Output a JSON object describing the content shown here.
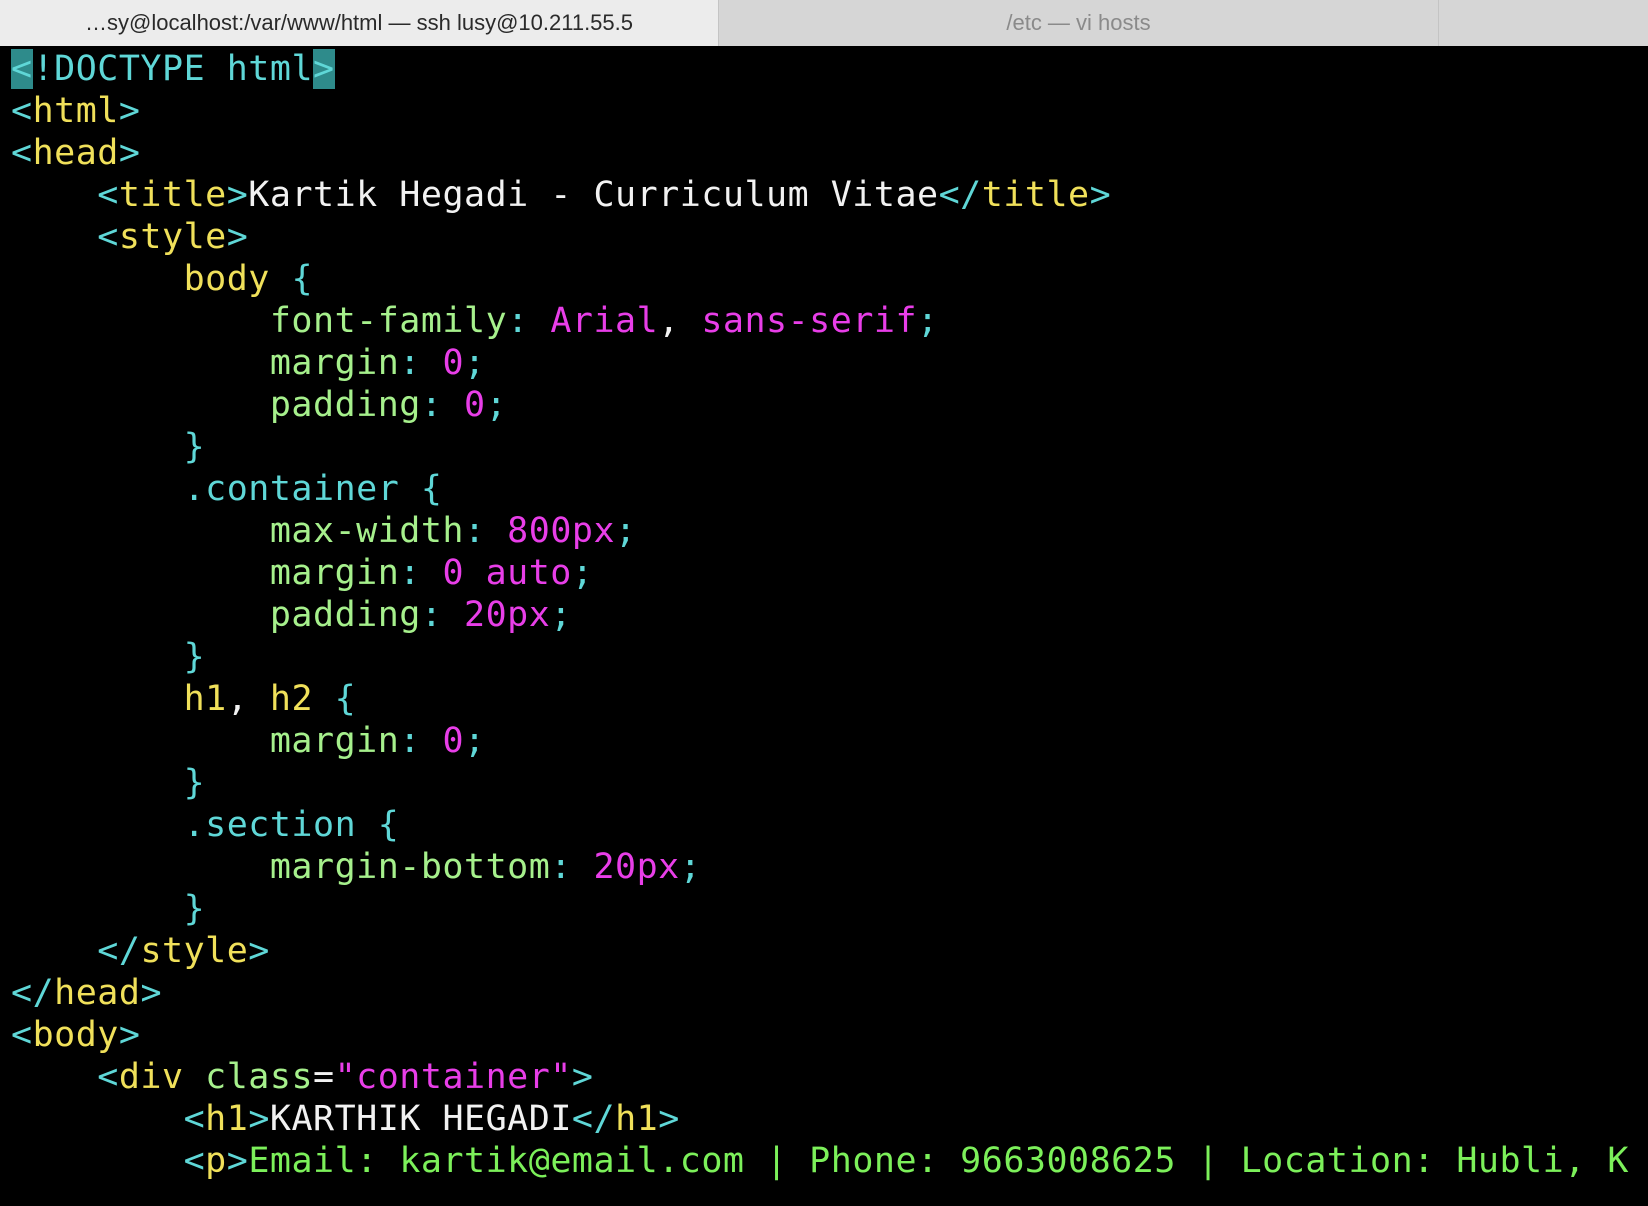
{
  "tabs": [
    {
      "label": "…sy@localhost:/var/www/html — ssh lusy@10.211.55.5",
      "active": true
    },
    {
      "label": "/etc — vi hosts",
      "active": false
    }
  ],
  "colors": {
    "background": "#000000",
    "tag": "#5fd7d7",
    "tag_name": "#f0e05a",
    "text": "#f2f2f2",
    "property": "#a6f08c",
    "value": "#e83ee8",
    "cursor": "#2e8b8b"
  },
  "lines": [
    [
      {
        "t": "<",
        "c": "cursor"
      },
      {
        "t": "!DOCTYPE html",
        "c": "c-cyan"
      },
      {
        "t": ">",
        "c": "cursor"
      }
    ],
    [
      {
        "t": "<",
        "c": "c-cyan"
      },
      {
        "t": "html",
        "c": "c-yellow"
      },
      {
        "t": ">",
        "c": "c-cyan"
      }
    ],
    [
      {
        "t": "<",
        "c": "c-cyan"
      },
      {
        "t": "head",
        "c": "c-yellow"
      },
      {
        "t": ">",
        "c": "c-cyan"
      }
    ],
    [
      {
        "t": "    <",
        "c": "c-cyan"
      },
      {
        "t": "title",
        "c": "c-yellow"
      },
      {
        "t": ">",
        "c": "c-cyan"
      },
      {
        "t": "Kartik Hegadi - Curriculum Vitae",
        "c": "c-white"
      },
      {
        "t": "</",
        "c": "c-cyan"
      },
      {
        "t": "title",
        "c": "c-yellow"
      },
      {
        "t": ">",
        "c": "c-cyan"
      }
    ],
    [
      {
        "t": "    <",
        "c": "c-cyan"
      },
      {
        "t": "style",
        "c": "c-yellow"
      },
      {
        "t": ">",
        "c": "c-cyan"
      }
    ],
    [
      {
        "t": "        body ",
        "c": "c-yellow"
      },
      {
        "t": "{",
        "c": "c-cyan"
      }
    ],
    [
      {
        "t": "            font-family",
        "c": "c-green"
      },
      {
        "t": ": ",
        "c": "c-cyan"
      },
      {
        "t": "Arial",
        "c": "c-magenta"
      },
      {
        "t": ", ",
        "c": "c-white"
      },
      {
        "t": "sans-serif",
        "c": "c-magenta"
      },
      {
        "t": ";",
        "c": "c-cyan"
      }
    ],
    [
      {
        "t": "            margin",
        "c": "c-green"
      },
      {
        "t": ": ",
        "c": "c-cyan"
      },
      {
        "t": "0",
        "c": "c-magenta"
      },
      {
        "t": ";",
        "c": "c-cyan"
      }
    ],
    [
      {
        "t": "            padding",
        "c": "c-green"
      },
      {
        "t": ": ",
        "c": "c-cyan"
      },
      {
        "t": "0",
        "c": "c-magenta"
      },
      {
        "t": ";",
        "c": "c-cyan"
      }
    ],
    [
      {
        "t": "        }",
        "c": "c-cyan"
      }
    ],
    [
      {
        "t": "        .container ",
        "c": "c-cyan"
      },
      {
        "t": "{",
        "c": "c-cyan"
      }
    ],
    [
      {
        "t": "            max-width",
        "c": "c-green"
      },
      {
        "t": ": ",
        "c": "c-cyan"
      },
      {
        "t": "800px",
        "c": "c-magenta"
      },
      {
        "t": ";",
        "c": "c-cyan"
      }
    ],
    [
      {
        "t": "            margin",
        "c": "c-green"
      },
      {
        "t": ": ",
        "c": "c-cyan"
      },
      {
        "t": "0 auto",
        "c": "c-magenta"
      },
      {
        "t": ";",
        "c": "c-cyan"
      }
    ],
    [
      {
        "t": "            padding",
        "c": "c-green"
      },
      {
        "t": ": ",
        "c": "c-cyan"
      },
      {
        "t": "20px",
        "c": "c-magenta"
      },
      {
        "t": ";",
        "c": "c-cyan"
      }
    ],
    [
      {
        "t": "        }",
        "c": "c-cyan"
      }
    ],
    [
      {
        "t": "        h1",
        "c": "c-yellow"
      },
      {
        "t": ", ",
        "c": "c-white"
      },
      {
        "t": "h2 ",
        "c": "c-yellow"
      },
      {
        "t": "{",
        "c": "c-cyan"
      }
    ],
    [
      {
        "t": "            margin",
        "c": "c-green"
      },
      {
        "t": ": ",
        "c": "c-cyan"
      },
      {
        "t": "0",
        "c": "c-magenta"
      },
      {
        "t": ";",
        "c": "c-cyan"
      }
    ],
    [
      {
        "t": "        }",
        "c": "c-cyan"
      }
    ],
    [
      {
        "t": "        .section ",
        "c": "c-cyan"
      },
      {
        "t": "{",
        "c": "c-cyan"
      }
    ],
    [
      {
        "t": "            margin-bottom",
        "c": "c-green"
      },
      {
        "t": ": ",
        "c": "c-cyan"
      },
      {
        "t": "20px",
        "c": "c-magenta"
      },
      {
        "t": ";",
        "c": "c-cyan"
      }
    ],
    [
      {
        "t": "        }",
        "c": "c-cyan"
      }
    ],
    [
      {
        "t": "    </",
        "c": "c-cyan"
      },
      {
        "t": "style",
        "c": "c-yellow"
      },
      {
        "t": ">",
        "c": "c-cyan"
      }
    ],
    [
      {
        "t": "</",
        "c": "c-cyan"
      },
      {
        "t": "head",
        "c": "c-yellow"
      },
      {
        "t": ">",
        "c": "c-cyan"
      }
    ],
    [
      {
        "t": "<",
        "c": "c-cyan"
      },
      {
        "t": "body",
        "c": "c-yellow"
      },
      {
        "t": ">",
        "c": "c-cyan"
      }
    ],
    [
      {
        "t": "    <",
        "c": "c-cyan"
      },
      {
        "t": "div ",
        "c": "c-yellow"
      },
      {
        "t": "class",
        "c": "c-green"
      },
      {
        "t": "=",
        "c": "c-white"
      },
      {
        "t": "\"container\"",
        "c": "c-magenta"
      },
      {
        "t": ">",
        "c": "c-cyan"
      }
    ],
    [
      {
        "t": "        <",
        "c": "c-cyan"
      },
      {
        "t": "h1",
        "c": "c-yellow"
      },
      {
        "t": ">",
        "c": "c-cyan"
      },
      {
        "t": "KARTHIK HEGADI",
        "c": "c-white"
      },
      {
        "t": "</",
        "c": "c-cyan"
      },
      {
        "t": "h1",
        "c": "c-yellow"
      },
      {
        "t": ">",
        "c": "c-cyan"
      }
    ],
    [
      {
        "t": "        <",
        "c": "c-cyan"
      },
      {
        "t": "p",
        "c": "c-yellow"
      },
      {
        "t": ">",
        "c": "c-cyan"
      },
      {
        "t": "Email: kartik@email.com | Phone: 9663008625 | Location: Hubli, K",
        "c": "c-bright-green"
      }
    ]
  ]
}
